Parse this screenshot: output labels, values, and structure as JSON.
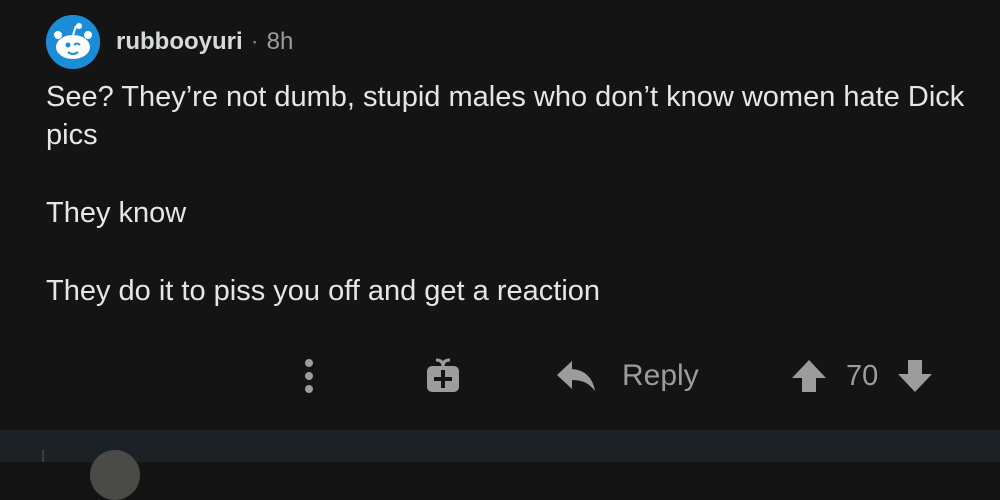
{
  "comment": {
    "username": "rubbooyuri",
    "separator": "·",
    "time": "8h",
    "paragraphs": [
      "See? They’re not dumb, stupid males who don’t know women hate Dick pics",
      "They know",
      "They do it to piss you off and get a reaction"
    ]
  },
  "actions": {
    "more_icon": "more-vertical-icon",
    "award_icon": "gift-award-icon",
    "reply_label": "Reply",
    "reply_icon": "reply-arrow-icon",
    "upvote_icon": "upvote-arrow-icon",
    "score": "70",
    "downvote_icon": "downvote-arrow-icon"
  },
  "colors": {
    "background": "#141414",
    "avatar_bg": "#1a8cd8",
    "icon_gray": "#9a9c9e",
    "next_bg": "#1c2126"
  }
}
